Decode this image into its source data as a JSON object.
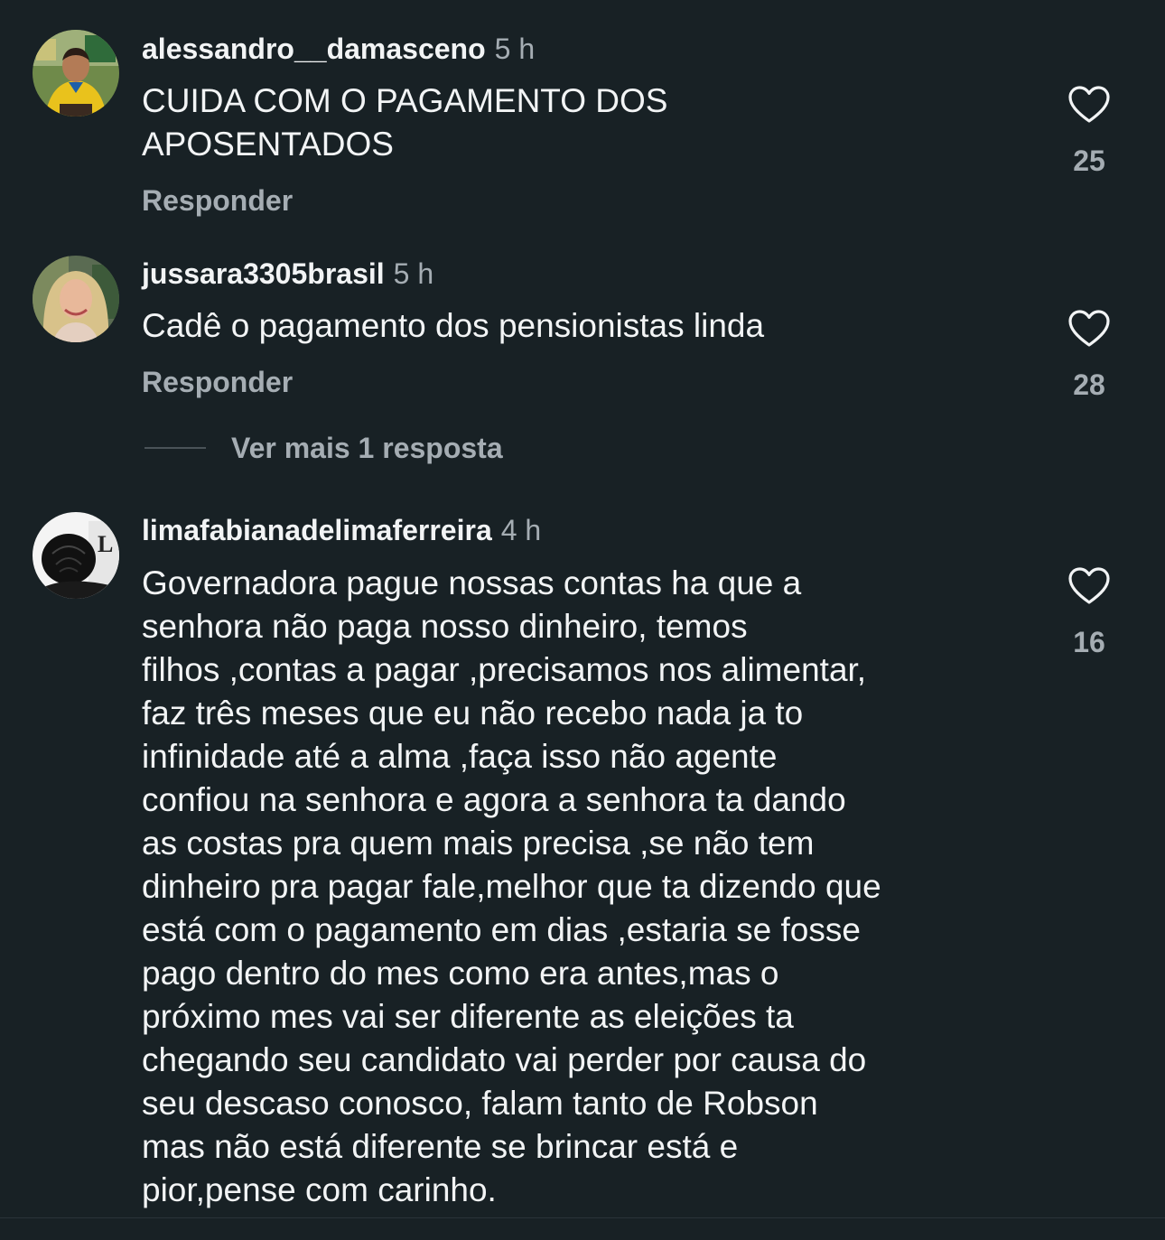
{
  "comments": [
    {
      "username": "alessandro__damasceno",
      "time": "5 h",
      "text": "CUIDA COM O PAGAMENTO DOS\nAPOSENTADOS",
      "reply_label": "Responder",
      "likes": "25",
      "avatar_icon": "user-photo-man-yellow-shirt"
    },
    {
      "username": "jussara3305brasil",
      "time": "5 h",
      "text": "Cadê o pagamento dos pensionistas linda",
      "reply_label": "Responder",
      "likes": "28",
      "avatar_icon": "user-photo-woman-blonde",
      "more_replies_label": "Ver mais 1 resposta"
    },
    {
      "username": "limafabianadelimaferreira",
      "time": "4 h",
      "text": "Governadora pague nossas contas ha que a\nsenhora não paga nosso dinheiro, temos\nfilhos ,contas a pagar ,precisamos nos alimentar,\nfaz três meses que eu não recebo nada ja to\ninfinidade até a alma ,faça isso não agente\nconfiou na senhora e agora a senhora ta dando\nas costas pra quem mais precisa ,se não tem\ndinheiro pra pagar fale,melhor que ta dizendo que\nestá com o pagamento em dias ,estaria se fosse\npago dentro do mes como era antes,mas o\npróximo mes vai ser diferente as eleições ta\nchegando seu candidato vai perder por causa do\nseu descaso conosco, falam tanto de Robson\nmas não está diferente se brincar está e\npior,pense com carinho.",
      "likes": "16",
      "avatar_icon": "user-photo-black-rose"
    }
  ],
  "colors": {
    "background": "#182125",
    "primary_text": "#f2f4f5",
    "secondary_text": "#a5adb3"
  }
}
